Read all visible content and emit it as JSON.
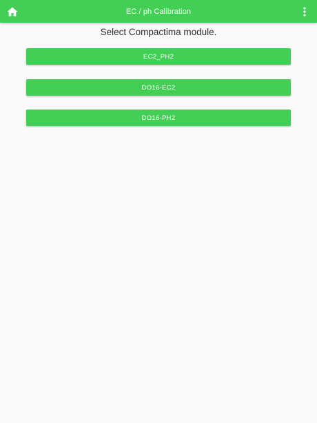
{
  "appbar": {
    "title": "EC / ph Calibration",
    "home_icon": "home-icon",
    "menu_icon": "more-vertical-icon"
  },
  "main": {
    "heading": "Select Compactima module.",
    "modules": [
      {
        "label": "EC2_PH2"
      },
      {
        "label": "DO16-EC2"
      },
      {
        "label": "DO16-PH2"
      }
    ]
  },
  "colors": {
    "accent": "#43cf55",
    "background": "#fafafa",
    "text": "#2a2a2a"
  }
}
